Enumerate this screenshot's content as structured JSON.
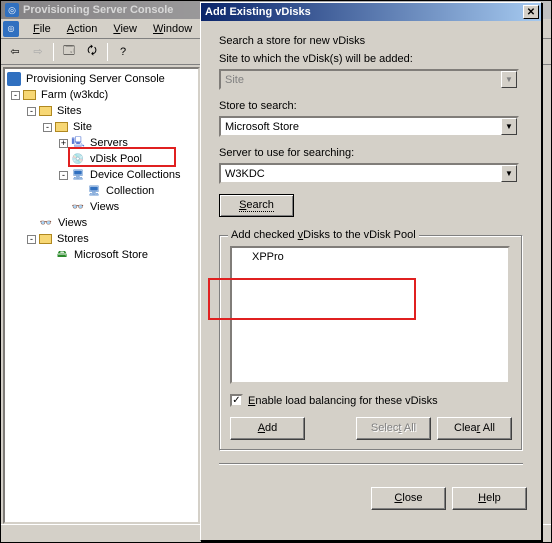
{
  "app": {
    "title": "Provisioning Server Console",
    "menu": {
      "file": "File",
      "action": "Action",
      "view": "View",
      "window": "Window"
    }
  },
  "tree": {
    "root": "Provisioning Server Console",
    "farm": "Farm (w3kdc)",
    "sites": "Sites",
    "site": "Site",
    "servers": "Servers",
    "vdiskpool": "vDisk Pool",
    "devicecoll": "Device Collections",
    "collection": "Collection",
    "viewsNode": "Views",
    "views2": "Views",
    "stores": "Stores",
    "msstore": "Microsoft Store"
  },
  "dialog": {
    "title": "Add Existing vDisks",
    "intro": "Search a store for new vDisks",
    "siteLabel": "Site to which the vDisk(s) will be added:",
    "siteValue": "Site",
    "storeLabel": "Store to search:",
    "storeValue": "Microsoft Store",
    "serverLabel": "Server to use for searching:",
    "serverValue": "W3KDC",
    "searchBtn": "Search",
    "groupLabel": "Add checked vDisks to the vDisk Pool",
    "listItem1": "XPPro",
    "enableLB": "Enable load balancing for these vDisks",
    "addBtn": "Add",
    "selectAllBtn": "Select All",
    "clearAllBtn": "Clear All",
    "closeBtn": "Close",
    "helpBtn": "Help"
  }
}
